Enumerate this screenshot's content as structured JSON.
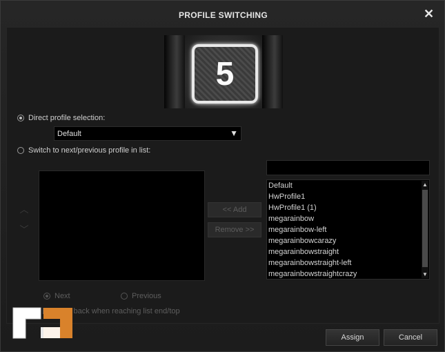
{
  "dialog": {
    "title": "PROFILE SWITCHING",
    "close_glyph": "✕"
  },
  "badge": {
    "number": "5"
  },
  "direct": {
    "label": "Direct profile selection:",
    "selected": true,
    "dropdown_value": "Default",
    "dropdown_arrow": "▼"
  },
  "next_prev": {
    "label": "Switch to next/previous profile in list:",
    "selected": false
  },
  "order_buttons": {
    "up_glyph": "︿",
    "down_glyph": "﹀"
  },
  "transfer": {
    "add_label": "<< Add",
    "remove_label": "Remove >>"
  },
  "profiles": {
    "items": [
      "Default",
      "HwProfile1",
      "HwProfile1 (1)",
      "megarainbow",
      "megarainbow-left",
      "megarainbowcarazy",
      "megarainbowstraight",
      "megarainbowstraight-left",
      "megarainbowstraightcrazy"
    ],
    "scroll_up_glyph": "▲",
    "scroll_down_glyph": "▼"
  },
  "direction": {
    "next_label": "Next",
    "previous_label": "Previous",
    "next_selected": true
  },
  "loop": {
    "label": "Loop back when reaching list end/top",
    "checked": false
  },
  "footer": {
    "assign_label": "Assign",
    "cancel_label": "Cancel"
  },
  "colors": {
    "background": "#1e1e1e",
    "field": "#000000",
    "text": "#d0d0d0",
    "disabled_text": "#5e5e5e",
    "logo_orange": "#d9822b"
  }
}
